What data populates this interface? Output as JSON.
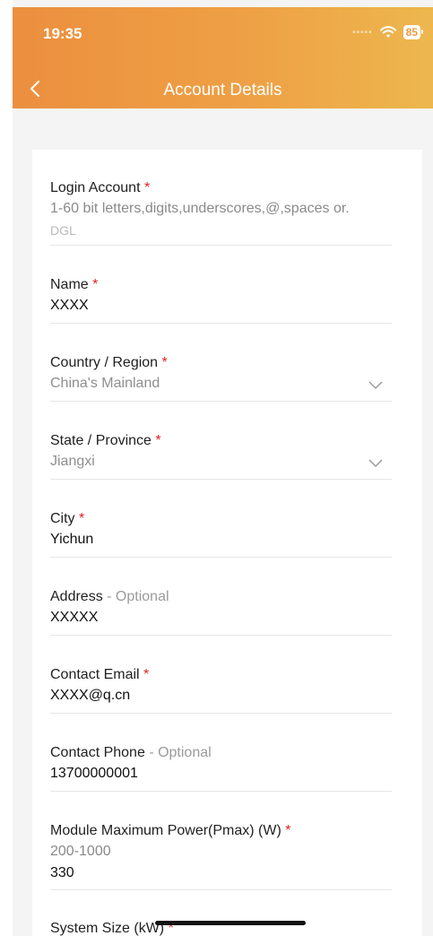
{
  "status_bar": {
    "time": "19:35",
    "battery": "85"
  },
  "header": {
    "title": "Account Details"
  },
  "form": {
    "login_account": {
      "label": "Login Account",
      "required_mark": "*",
      "hint": "1-60 bit letters,digits,underscores,@,spaces or.",
      "placeholder": "DGL"
    },
    "name": {
      "label": "Name",
      "required_mark": "*",
      "value": "XXXX"
    },
    "country": {
      "label": "Country / Region",
      "required_mark": "*",
      "value": "China's Mainland"
    },
    "state": {
      "label": "State / Province",
      "required_mark": "*",
      "value": "Jiangxi"
    },
    "city": {
      "label": "City",
      "required_mark": "*",
      "value": "Yichun"
    },
    "address": {
      "label": "Address",
      "optional": "- Optional",
      "value": "XXXXX"
    },
    "email": {
      "label": "Contact Email",
      "required_mark": "*",
      "value": "XXXX@q.cn"
    },
    "phone": {
      "label": "Contact Phone",
      "optional": "- Optional",
      "value": "13700000001"
    },
    "module_power": {
      "label": "Module Maximum Power(Pmax) (W)",
      "required_mark": "*",
      "hint": "200-1000",
      "value": "330"
    },
    "system_size": {
      "label": "System Size (kW)",
      "required_mark": "*"
    }
  }
}
